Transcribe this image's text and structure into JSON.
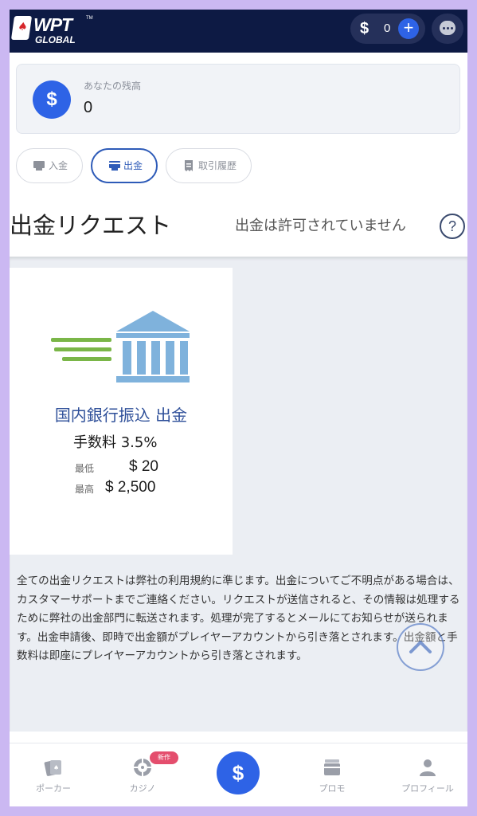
{
  "header": {
    "logo_wpt": "WPT",
    "logo_tm": "TM",
    "logo_global": "GLOBAL",
    "wallet_symbol": "$",
    "wallet_value": "0",
    "wallet_add": "+",
    "chat_icon": "chat-bubble-icon"
  },
  "balance": {
    "label": "あなたの残高",
    "value": "0",
    "icon": "$"
  },
  "tabs": [
    {
      "label": "入金",
      "icon": "deposit-icon",
      "active": false
    },
    {
      "label": "出金",
      "icon": "withdraw-icon",
      "active": true
    },
    {
      "label": "取引履歴",
      "icon": "receipt-icon",
      "active": false
    }
  ],
  "page": {
    "title": "出金リクエスト",
    "status": "出金は許可されていません",
    "help": "?"
  },
  "method": {
    "name": "国内銀行振込 出金",
    "fee": "手数料  3.5%",
    "min_label": "最低",
    "min_value": "$ 20",
    "max_label": "最高",
    "max_value": "$ 2,500",
    "icon": "bank-icon"
  },
  "terms": "全ての出金リクエストは弊社の利用規約に準じます。出金についてご不明点がある場合は、カスタマーサポートまでご連絡ください。リクエストが送信されると、その情報は処理するために弊社の出金部門に転送されます。処理が完了するとメールにてお知らせが送られます。出金申請後、即時で出金額がプレイヤーアカウントから引き落とされます。出金額と手数料は即座にプレイヤーアカウントから引き落とされます。",
  "bottom_nav": {
    "poker": "ポーカー",
    "casino": "カジノ",
    "casino_badge": "新作",
    "cashier": "$",
    "promo": "プロモ",
    "profile": "プロフィール"
  },
  "colors": {
    "header_bg": "#0d1a44",
    "accent": "#2e63e6",
    "active_tab": "#2e5bb8",
    "bank_blue": "#7fb2dc",
    "bank_green": "#7ab648",
    "badge": "#e44e6d"
  }
}
